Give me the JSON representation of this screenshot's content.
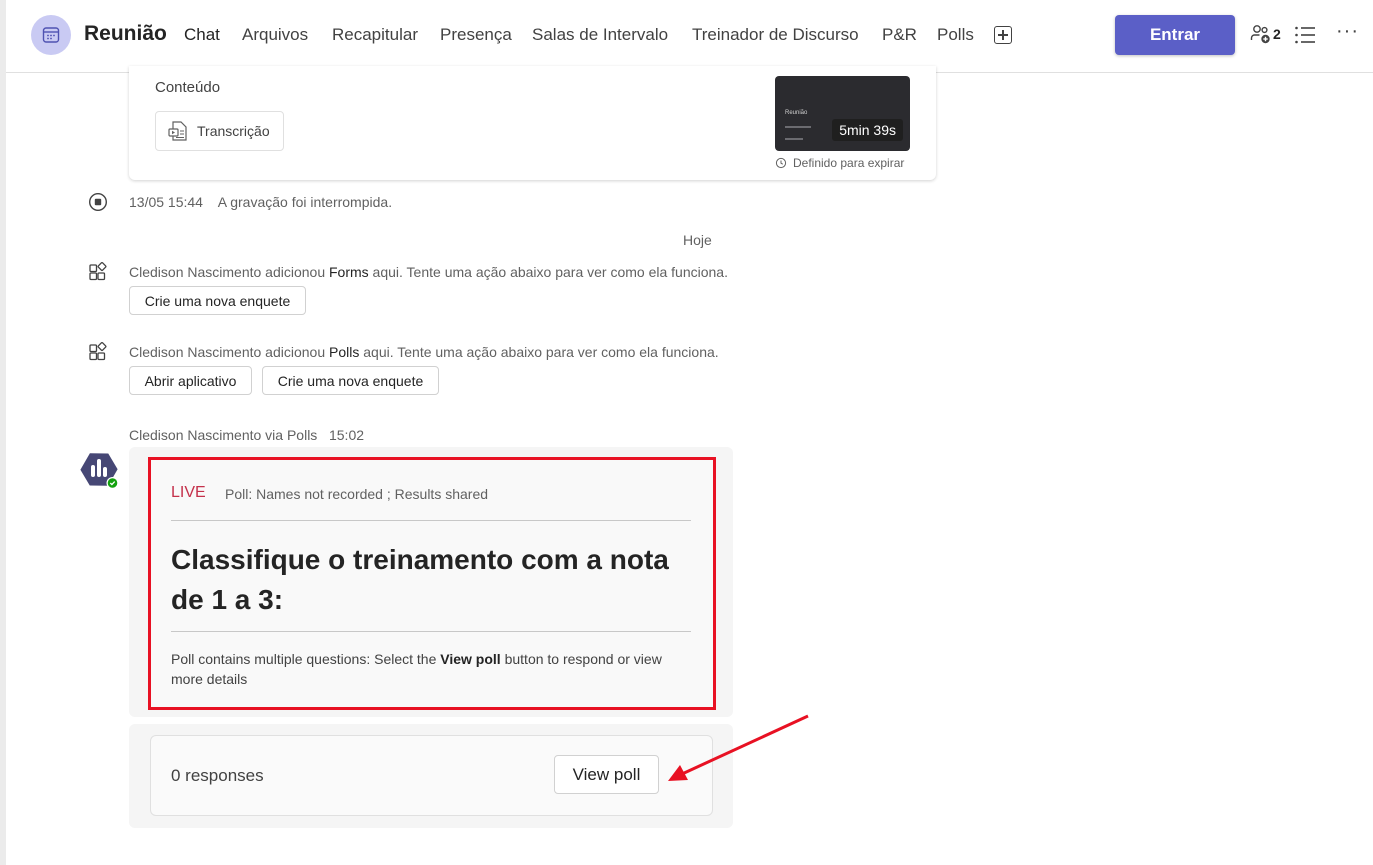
{
  "header": {
    "title": "Reunião",
    "tabs": [
      {
        "label": "Chat",
        "active": true
      },
      {
        "label": "Arquivos"
      },
      {
        "label": "Recapitular"
      },
      {
        "label": "Presença"
      },
      {
        "label": "Salas de Intervalo"
      },
      {
        "label": "Treinador de Discurso"
      },
      {
        "label": "P&R"
      },
      {
        "label": "Polls"
      }
    ],
    "join_label": "Entrar",
    "participants_count": "2"
  },
  "recording": {
    "content_label": "Conteúdo",
    "transcript_label": "Transcrição",
    "thumbnail_title": "Reunião",
    "duration": "5min 39s",
    "expire_label": "Definido para expirar"
  },
  "events": {
    "stopped_time": "13/05 15:44",
    "stopped_text": "A gravação foi interrompida.",
    "date_separator": "Hoje",
    "forms_added": {
      "pre": "Cledison Nascimento adicionou ",
      "app": "Forms",
      "post": " aqui. Tente uma ação abaixo para ver como ela funciona.",
      "button": "Crie uma nova enquete"
    },
    "polls_added": {
      "pre": "Cledison Nascimento adicionou ",
      "app": "Polls",
      "post": " aqui. Tente uma ação abaixo para ver como ela funciona.",
      "open_button": "Abrir aplicativo",
      "create_button": "Crie uma nova enquete"
    }
  },
  "poll_message": {
    "sender": "Cledison Nascimento via Polls",
    "time": "15:02",
    "status": "LIVE",
    "meta": "Poll: Names not recorded ; Results shared",
    "question": "Classifique o treinamento com a nota de 1 a 3:",
    "note_pre": "Poll contains multiple questions: Select the ",
    "note_bold": "View poll",
    "note_post": " button to respond or view more details",
    "responses": "0 responses",
    "view_button": "View poll"
  },
  "colors": {
    "accent": "#5b5fc7",
    "live": "#c4314b",
    "highlight_border": "#e81123",
    "annotation_arrow": "#e81123",
    "online_badge": "#13a10e"
  }
}
